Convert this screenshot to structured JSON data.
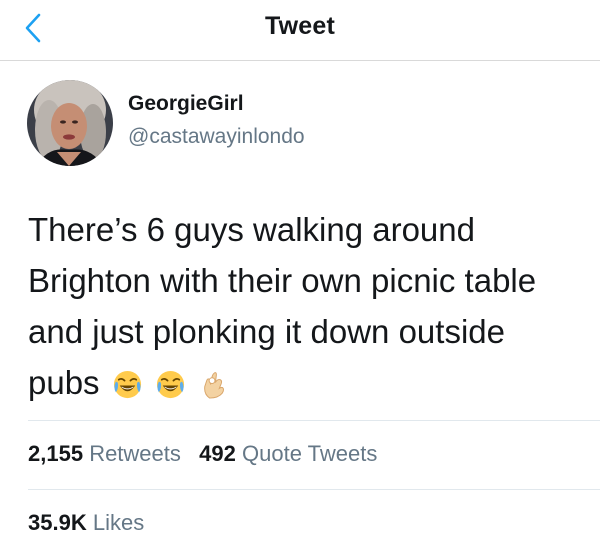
{
  "header": {
    "title": "Tweet"
  },
  "author": {
    "name": "GeorgieGirl",
    "handle": "@castawayinlondo"
  },
  "tweet": {
    "lines": [
      "There’s 6 guys walking around",
      "Brighton with their own picnic table",
      "and just plonking it down outside",
      "pubs"
    ],
    "emojis": [
      "face-with-tears-of-joy-icon",
      "face-with-tears-of-joy-icon",
      "ok-hand-icon"
    ]
  },
  "stats": {
    "retweets_count": "2,155",
    "retweets_label": "Retweets",
    "quotes_count": "492",
    "quotes_label": "Quote Tweets",
    "likes_count": "35.9K",
    "likes_label": "Likes"
  },
  "colors": {
    "accent": "#1da1f2",
    "text": "#14171a",
    "secondary": "#657786",
    "divider": "#e1e8ed"
  }
}
